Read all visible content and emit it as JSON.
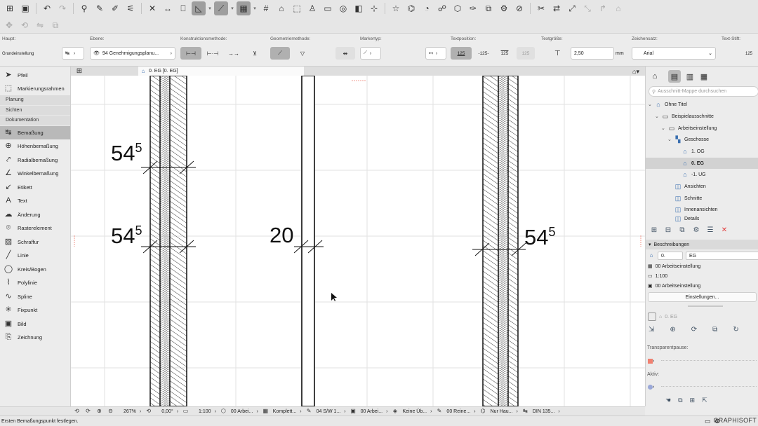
{
  "toolbar": {
    "icons": [
      "grid-icon",
      "save-icon",
      "undo-icon",
      "redo-icon",
      "find-select-icon",
      "pick-up-icon",
      "inject-icon",
      "magic-wand-icon",
      "trace-icon",
      "dimension-icon",
      "guide-line-icon",
      "snap-icon",
      "grid-snap-icon",
      "roof-icon",
      "elevate-icon",
      "layer-icon",
      "view-icon",
      "favorite-icon",
      "mesh-icon",
      "lamp-icon",
      "morph-icon",
      "surface-icon",
      "door-icon",
      "pen-set-icon",
      "model-view-icon",
      "renovation-icon",
      "split-icon",
      "merge-icon",
      "adjust-icon",
      "offset-icon",
      "fillet-icon",
      "explode-icon"
    ]
  },
  "infobox": {
    "haupt_label": "Haupt:",
    "haupt_value": "Grundeinstellung",
    "ebene_label": "Ebene:",
    "ebene_value": "94 Genehmigungsplanu...",
    "konstruktion_label": "Konstruktionsmethode:",
    "geometrie_label": "Geometriemethode:",
    "markertyp_label": "Markertyp:",
    "textposition_label": "Textposition:",
    "textpos_a": "125",
    "textpos_b": "-125-",
    "textpos_c": "125",
    "textpos_d": "125",
    "textgroesse_label": "Textgröße:",
    "textgroesse_value": "2,50",
    "textgroesse_unit": "mm",
    "zeichensatz_label": "Zeichensatz:",
    "zeichensatz_value": "Arial",
    "textstift_label": "Text-Stift:",
    "textstift_value": "125"
  },
  "toolbox": {
    "items": [
      {
        "label": "Pfeil",
        "icon": "arrow-icon"
      },
      {
        "label": "Markierungsrahmen",
        "icon": "marquee-icon"
      }
    ],
    "categories": [
      "Planung",
      "Sichten",
      "Dokumentation"
    ],
    "doc_items": [
      {
        "label": "Bemaßung",
        "icon": "dimension-icon",
        "selected": true
      },
      {
        "label": "Höhenbemaßung",
        "icon": "level-dimension-icon"
      },
      {
        "label": "Radialbemaßung",
        "icon": "radial-dimension-icon"
      },
      {
        "label": "Winkelbemaßung",
        "icon": "angle-dimension-icon"
      },
      {
        "label": "Etikett",
        "icon": "label-icon"
      },
      {
        "label": "Text",
        "icon": "text-icon"
      },
      {
        "label": "Änderung",
        "icon": "revision-icon"
      },
      {
        "label": "Rasterelement",
        "icon": "grid-element-icon"
      },
      {
        "label": "Schraffur",
        "icon": "fill-icon"
      },
      {
        "label": "Linie",
        "icon": "line-icon"
      },
      {
        "label": "Kreis/Bogen",
        "icon": "arc-icon"
      },
      {
        "label": "Polylinie",
        "icon": "polyline-icon"
      },
      {
        "label": "Spline",
        "icon": "spline-icon"
      },
      {
        "label": "Fixpunkt",
        "icon": "hotspot-icon"
      },
      {
        "label": "Bild",
        "icon": "image-icon"
      },
      {
        "label": "Zeichnung",
        "icon": "drawing-icon"
      }
    ]
  },
  "tabs": {
    "active": "0. EG [0. EG]"
  },
  "canvas": {
    "dim_label_1": "54",
    "dim_label_1_sup": "5",
    "dim_label_2": "54",
    "dim_label_2_sup": "5",
    "dim_label_3": "20",
    "dim_label_4": "54",
    "dim_label_4_sup": "5"
  },
  "navigator": {
    "search_placeholder": "Ausschnitt-Mappe durchsuchen",
    "tree": [
      {
        "label": "Ohne Titel",
        "level": 0,
        "arrow": "down",
        "icon": "project-icon"
      },
      {
        "label": "Beispielausschnitte",
        "level": 1,
        "arrow": "down",
        "icon": "folder-icon"
      },
      {
        "label": "Arbeitseinstellung",
        "level": 2,
        "arrow": "down",
        "icon": "folder-icon"
      },
      {
        "label": "Geschosse",
        "level": 3,
        "arrow": "down",
        "icon": "stories-icon"
      },
      {
        "label": "1. OG",
        "level": 4,
        "arrow": "",
        "icon": "story-icon"
      },
      {
        "label": "0. EG",
        "level": 4,
        "arrow": "",
        "icon": "story-icon",
        "selected": true
      },
      {
        "label": "-1. UG",
        "level": 4,
        "arrow": "",
        "icon": "story-icon"
      },
      {
        "label": "Ansichten",
        "level": 3,
        "arrow": "",
        "icon": "elevation-icon"
      },
      {
        "label": "Schnitte",
        "level": 3,
        "arrow": "",
        "icon": "section-icon"
      },
      {
        "label": "Innenansichten",
        "level": 3,
        "arrow": "",
        "icon": "interior-icon"
      },
      {
        "label": "Details",
        "level": 3,
        "arrow": "",
        "icon": "detail-icon"
      }
    ],
    "descriptions_title": "Beschreibungen",
    "desc_id": "0.",
    "desc_name": "EG",
    "desc_row1": "00 Arbeitseinstellung",
    "desc_row2": "1:100",
    "desc_row3": "00 Arbeitseinstellung",
    "settings_button": "Einstellungen...",
    "preview_name": "0. EG",
    "transparent_label": "Transparentpause:",
    "aktiv_label": "Aktiv:"
  },
  "statusbar": {
    "zoom": "267%",
    "angle": "0,00°",
    "scale": "1:100",
    "layers": "00 Arbei...",
    "complete": "Komplett...",
    "pens": "04 S/W 1...",
    "model": "00 Arbei...",
    "override": "Keine Üb...",
    "renovation": "00 Reine...",
    "structure": "Nur Hau...",
    "din": "DIN 135..."
  },
  "bottom": {
    "message": "Ersten Bemaßungspunkt festlegen.",
    "brand": "GRAPHISOFT"
  },
  "colors": {
    "selection": "#b9b9b9",
    "delete": "#e23b3b",
    "marker": "#f08070"
  }
}
